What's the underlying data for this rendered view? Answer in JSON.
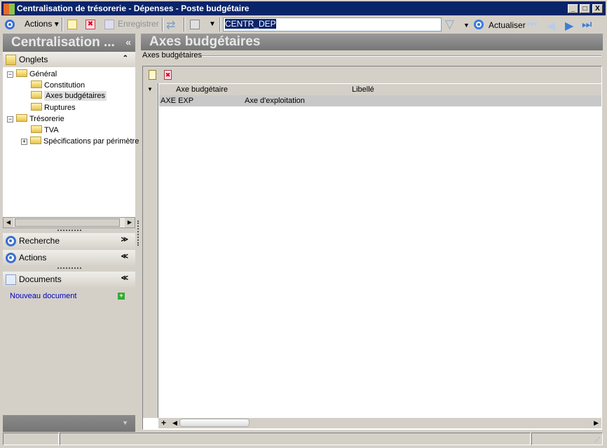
{
  "window": {
    "title": "Centralisation de trésorerie - Dépenses -  Poste budgétaire",
    "minimize": "_",
    "maximize": "□",
    "close": "X"
  },
  "toolbar": {
    "actions_label": "Actions",
    "save_label": "Enregistrer",
    "search_value": "CENTR_DEP",
    "refresh_label": "Actualiser"
  },
  "left_panel": {
    "title": "Centralisation ...",
    "collapse": "«",
    "onglets": {
      "label": "Onglets",
      "chevron": "⌃"
    },
    "tree": [
      {
        "label": "Général",
        "toggle": "−"
      },
      {
        "label": "Constitution"
      },
      {
        "label": "Axes budgétaires"
      },
      {
        "label": "Ruptures"
      },
      {
        "label": "Trésorerie",
        "toggle": "−"
      },
      {
        "label": "TVA"
      },
      {
        "label": "Spécifications par périmètre",
        "toggle": "+"
      }
    ],
    "sections": [
      {
        "label": "Recherche",
        "chevron": "≫"
      },
      {
        "label": "Actions",
        "chevron": "≪"
      },
      {
        "label": "Documents",
        "chevron": "≪"
      }
    ],
    "new_document": "Nouveau document"
  },
  "main": {
    "title": "Axes budgétaires",
    "group_label": "Axes budgétaires",
    "columns": [
      "Axe budgétaire",
      "Libellé"
    ],
    "rows": [
      {
        "axe": "AXE EXP",
        "libelle": "Axe d'exploitation"
      }
    ],
    "add_row": "+"
  },
  "colors": {
    "titlebar": "#0a246a",
    "selected_row": "#c8c8c8",
    "link": "#0000c0"
  }
}
